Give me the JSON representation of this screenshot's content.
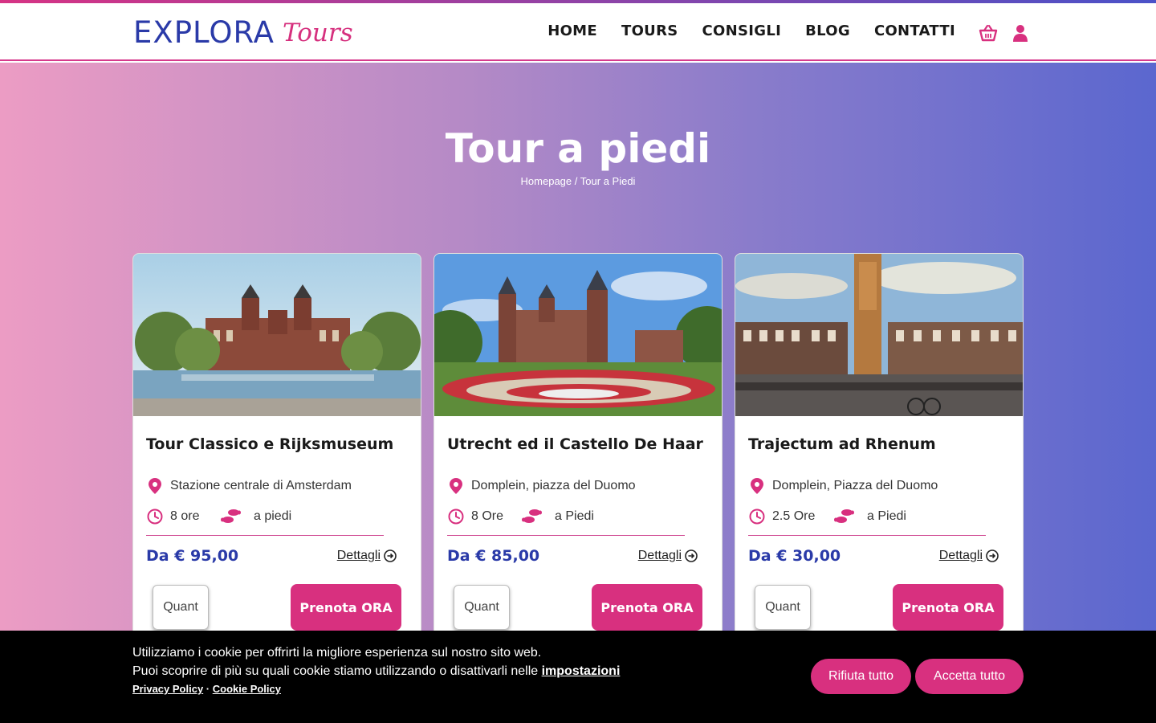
{
  "brand": {
    "name_main": "EXPLORA",
    "name_script": "Tours",
    "primary_color": "#2a3aa8",
    "accent_color": "#d8307f"
  },
  "nav": {
    "items": [
      "HOME",
      "TOURS",
      "CONSIGLI",
      "BLOG",
      "CONTATTI"
    ],
    "icons": [
      "basket-icon",
      "user-icon"
    ]
  },
  "hero": {
    "title": "Tour a piedi",
    "breadcrumb": {
      "home": "Homepage",
      "separator": "/",
      "current": "Tour a Piedi"
    }
  },
  "cards": [
    {
      "title": "Tour Classico e Rijksmuseum",
      "location": "Stazione centrale di Amsterdam",
      "duration": "8 ore",
      "mode": "a piedi",
      "price": "Da € 95,00",
      "details": "Dettagli",
      "qty_placeholder": "Quant",
      "book": "Prenota ORA"
    },
    {
      "title": "Utrecht ed il Castello De Haar",
      "location": "Domplein, piazza del Duomo",
      "duration": "8 Ore",
      "mode": "a Piedi",
      "price": "Da € 85,00",
      "details": "Dettagli",
      "qty_placeholder": "Quant",
      "book": "Prenota ORA"
    },
    {
      "title": "Trajectum ad Rhenum",
      "location": "Domplein, Piazza del Duomo",
      "duration": "2.5 Ore",
      "mode": "a Piedi",
      "price": "Da € 30,00",
      "details": "Dettagli",
      "qty_placeholder": "Quant",
      "book": "Prenota ORA"
    }
  ],
  "cookie": {
    "line1": "Utilizziamo i cookie per offrirti la migliore esperienza sul nostro sito web.",
    "line2": "Puoi scoprire di più su quali cookie stiamo utilizzando o disattivarli nelle",
    "settings_link": "impostazioni",
    "privacy": "Privacy Policy",
    "sep": " · ",
    "cookie_policy": "Cookie Policy",
    "reject": "Rifiuta tutto",
    "accept": "Accetta tutto"
  }
}
